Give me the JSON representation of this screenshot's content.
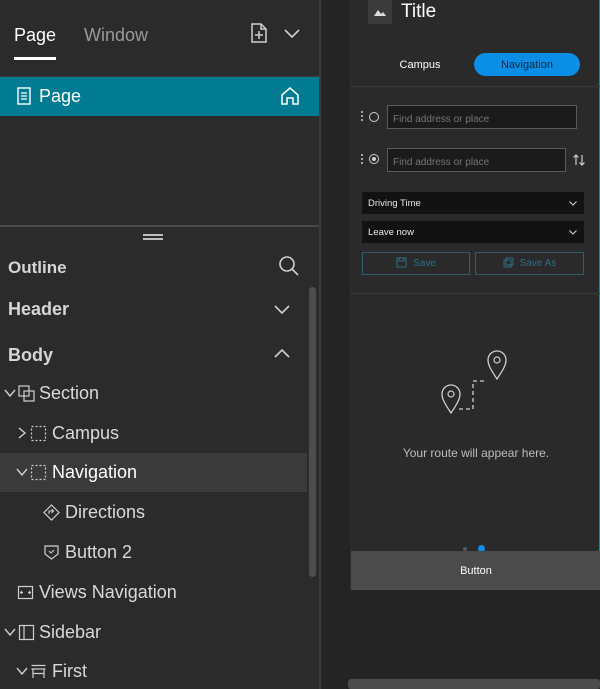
{
  "left_panel": {
    "tabs": {
      "page": "Page",
      "window": "Window"
    },
    "page_item": {
      "label": "Page"
    },
    "outline": {
      "title": "Outline",
      "header_section": "Header",
      "body_section": "Body",
      "tree": [
        {
          "label": "Section"
        },
        {
          "label": "Campus"
        },
        {
          "label": "Navigation"
        },
        {
          "label": "Directions"
        },
        {
          "label": "Button 2"
        },
        {
          "label": "Views Navigation"
        },
        {
          "label": "Sidebar"
        },
        {
          "label": "First"
        }
      ]
    }
  },
  "app": {
    "title": "Title",
    "segments": {
      "campus": "Campus",
      "navigation": "Navigation"
    },
    "directions": {
      "origin_placeholder": "Find address or place",
      "destination_placeholder": "Find address or place",
      "travel_mode": "Driving Time",
      "departure": "Leave now",
      "save_label": "Save",
      "save_as_label": "Save As"
    },
    "route_message": "Your route will appear here.",
    "button_label": "Button"
  },
  "colors": {
    "accent_teal": "#007b91",
    "accent_blue": "#0b8fe6"
  }
}
